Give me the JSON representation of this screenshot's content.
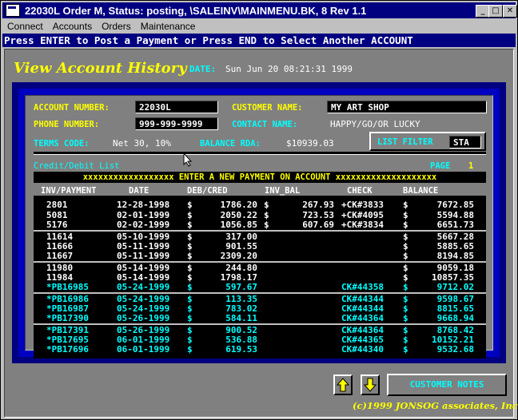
{
  "window": {
    "title": "22030L Order M, Status: posting, \\SALEINV\\MAINMENU.BK, 8 Rev 1.1",
    "min": "_",
    "max": "□",
    "close": "✕"
  },
  "menu": [
    "Connect",
    "Accounts",
    "Orders",
    "Maintenance"
  ],
  "prompt": "Press ENTER to Post a Payment or Press END to Select Another ACCOUNT",
  "header": {
    "title": "View Account History",
    "date_label": "DATE:",
    "date_value": "Sun Jun 20 08:21:31 1999"
  },
  "account": {
    "number_label": "ACCOUNT NUMBER:",
    "number": "22030L",
    "customer_label": "CUSTOMER NAME:",
    "customer": "MY ART SHOP",
    "phone_label": "PHONE NUMBER:",
    "phone": "999-999-9999",
    "contact_label": "CONTACT NAME:",
    "contact": "HAPPY/GO/OR LUCKY",
    "terms_label": "TERMS CODE:",
    "terms": "Net 30, 10%",
    "balance_label": "BALANCE RDA:",
    "balance": "$10939.03",
    "filter_label": "LIST FILTER",
    "filter": "STA"
  },
  "list": {
    "title": "Credit/Debit List",
    "page_label": "PAGE",
    "page": "1",
    "banner": "xxxxxxxxxxxxxxxxxx ENTER A NEW PAYMENT ON ACCOUNT xxxxxxxxxxxxxxxxxxxx",
    "columns": [
      "INV/PAYMENT",
      "DATE",
      "DEB/CRED",
      "INV_BAL",
      "CHECK",
      "BALANCE"
    ],
    "rows": [
      {
        "inv": "2801",
        "date": "12-28-1998",
        "d1": "$",
        "amt": "1786.20",
        "d2": "$",
        "bal": "267.93",
        "check": "+CK#3833",
        "d3": "$",
        "total": "7672.85",
        "color": "#ffffff"
      },
      {
        "inv": "5081",
        "date": "02-01-1999",
        "d1": "$",
        "amt": "2050.22",
        "d2": "$",
        "bal": "723.53",
        "check": "+CK#4095",
        "d3": "$",
        "total": "5594.88",
        "color": "#ffffff"
      },
      {
        "inv": "5176",
        "date": "02-02-1999",
        "d1": "$",
        "amt": "1056.85",
        "d2": "$",
        "bal": "607.69",
        "check": "+CK#3834",
        "d3": "$",
        "total": "6651.73",
        "color": "#ffffff"
      },
      {
        "inv": "11614",
        "date": "05-10-1999",
        "d1": "$",
        "amt": "317.00",
        "d2": "",
        "bal": "",
        "check": "",
        "d3": "$",
        "total": "5667.28",
        "color": "#ffffff"
      },
      {
        "inv": "11666",
        "date": "05-11-1999",
        "d1": "$",
        "amt": "901.55",
        "d2": "",
        "bal": "",
        "check": "",
        "d3": "$",
        "total": "5885.65",
        "color": "#ffffff"
      },
      {
        "inv": "11667",
        "date": "05-11-1999",
        "d1": "$",
        "amt": "2309.20",
        "d2": "",
        "bal": "",
        "check": "",
        "d3": "$",
        "total": "8194.85",
        "color": "#ffffff"
      },
      {
        "inv": "11980",
        "date": "05-14-1999",
        "d1": "$",
        "amt": "244.80",
        "d2": "",
        "bal": "",
        "check": "",
        "d3": "$",
        "total": "9059.18",
        "color": "#ffffff"
      },
      {
        "inv": "11984",
        "date": "05-14-1999",
        "d1": "$",
        "amt": "1798.17",
        "d2": "",
        "bal": "",
        "check": "",
        "d3": "$",
        "total": "10857.35",
        "color": "#ffffff"
      },
      {
        "inv": "*PB16985",
        "date": "05-24-1999",
        "d1": "$",
        "amt": "597.67",
        "d2": "",
        "bal": "",
        "check": "CK#44358",
        "d3": "$",
        "total": "9712.02",
        "color": "#00ffff"
      },
      {
        "inv": "*PB16986",
        "date": "05-24-1999",
        "d1": "$",
        "amt": "113.35",
        "d2": "",
        "bal": "",
        "check": "CK#44344",
        "d3": "$",
        "total": "9598.67",
        "color": "#00ffff"
      },
      {
        "inv": "*PB16987",
        "date": "05-24-1999",
        "d1": "$",
        "amt": "783.02",
        "d2": "",
        "bal": "",
        "check": "CK#44344",
        "d3": "$",
        "total": "8815.65",
        "color": "#00ffff"
      },
      {
        "inv": "*PB17390",
        "date": "05-26-1999",
        "d1": "$",
        "amt": "584.11",
        "d2": "",
        "bal": "",
        "check": "CK#44364",
        "d3": "$",
        "total": "9668.94",
        "color": "#00ffff"
      },
      {
        "inv": "*PB17391",
        "date": "05-26-1999",
        "d1": "$",
        "amt": "900.52",
        "d2": "",
        "bal": "",
        "check": "CK#44364",
        "d3": "$",
        "total": "8768.42",
        "color": "#00ffff"
      },
      {
        "inv": "*PB17695",
        "date": "06-01-1999",
        "d1": "$",
        "amt": "536.88",
        "d2": "",
        "bal": "",
        "check": "CK#44365",
        "d3": "$",
        "total": "10152.21",
        "color": "#00ffff"
      },
      {
        "inv": "*PB17696",
        "date": "06-01-1999",
        "d1": "$",
        "amt": "619.53",
        "d2": "",
        "bal": "",
        "check": "CK#44340",
        "d3": "$",
        "total": "9532.68",
        "color": "#00ffff"
      }
    ]
  },
  "buttons": {
    "notes": "CUSTOMER NOTES",
    "up_icon": "arrow-up-icon",
    "down_icon": "arrow-down-icon"
  },
  "copyright": "(c)1999 JONSOG associates, Inc."
}
